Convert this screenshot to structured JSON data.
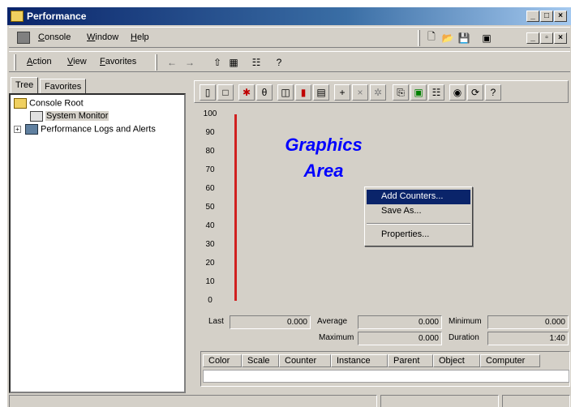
{
  "window": {
    "title": "Performance"
  },
  "menubar": {
    "items": [
      {
        "label": "Console",
        "key": "C"
      },
      {
        "label": "Window",
        "key": "W"
      },
      {
        "label": "Help",
        "key": "H"
      }
    ]
  },
  "actionbar": {
    "items": [
      {
        "label": "Action",
        "key": "A"
      },
      {
        "label": "View",
        "key": "V"
      },
      {
        "label": "Favorites",
        "key": "F"
      }
    ]
  },
  "left_tabs": [
    "Tree",
    "Favorites"
  ],
  "tree": {
    "root": "Console Root",
    "children": [
      "System Monitor",
      "Performance Logs and Alerts"
    ]
  },
  "graph": {
    "title_line1": "Graphics",
    "title_line2": "Area",
    "y_ticks": [
      "100",
      "90",
      "80",
      "70",
      "60",
      "50",
      "40",
      "30",
      "20",
      "10",
      "0"
    ]
  },
  "context_menu": {
    "items": [
      "Add Counters...",
      "Save As...",
      "Properties..."
    ],
    "selected": "Add Counters..."
  },
  "stats": {
    "last_label": "Last",
    "last_value": "0.000",
    "average_label": "Average",
    "average_value": "0.000",
    "minimum_label": "Minimum",
    "minimum_value": "0.000",
    "maximum_label": "Maximum",
    "maximum_value": "0.000",
    "duration_label": "Duration",
    "duration_value": "1:40"
  },
  "legend_columns": [
    "Color",
    "Scale",
    "Counter",
    "Instance",
    "Parent",
    "Object",
    "Computer"
  ],
  "colors": {
    "title_bar": "#0a246a",
    "graph_line": "#d02020",
    "graphics_text": "#0000ff",
    "selection": "#0a246a"
  }
}
